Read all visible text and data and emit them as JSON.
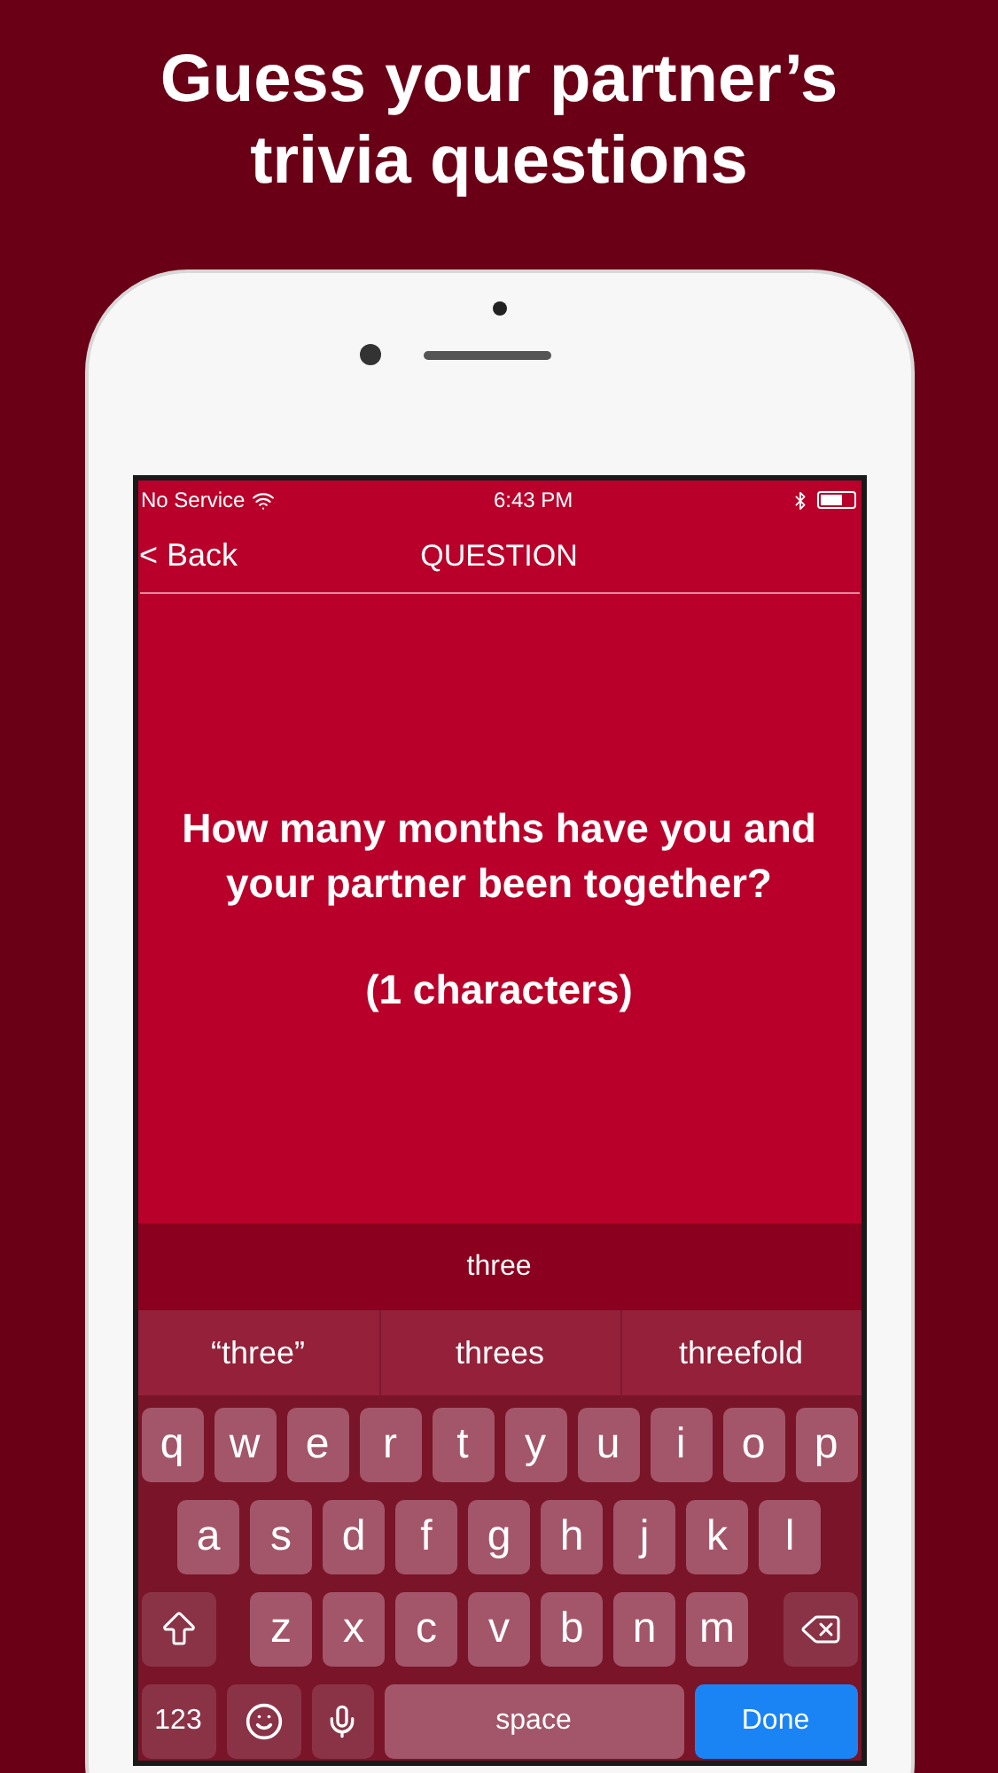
{
  "headline": "Guess your partner’s trivia questions",
  "status_bar": {
    "carrier": "No Service",
    "time": "6:43 PM"
  },
  "nav": {
    "back": "< Back",
    "title": "QUESTION"
  },
  "question": "How many months have you and your partner been together?",
  "hint": "(1 characters)",
  "input": {
    "value": "three"
  },
  "suggestions": [
    "“three”",
    "threes",
    "threefold"
  ],
  "keyboard": {
    "row_1": [
      {
        "kind": "letter",
        "label": "q"
      },
      {
        "kind": "letter",
        "label": "w"
      },
      {
        "kind": "letter",
        "label": "e"
      },
      {
        "kind": "letter",
        "label": "r"
      },
      {
        "kind": "letter",
        "label": "t"
      },
      {
        "kind": "letter",
        "label": "y"
      },
      {
        "kind": "letter",
        "label": "u"
      },
      {
        "kind": "letter",
        "label": "i"
      },
      {
        "kind": "letter",
        "label": "o"
      },
      {
        "kind": "letter",
        "label": "p"
      }
    ],
    "row_2": [
      {
        "kind": "letter",
        "label": "a"
      },
      {
        "kind": "letter",
        "label": "s"
      },
      {
        "kind": "letter",
        "label": "d"
      },
      {
        "kind": "letter",
        "label": "f"
      },
      {
        "kind": "letter",
        "label": "g"
      },
      {
        "kind": "letter",
        "label": "h"
      },
      {
        "kind": "letter",
        "label": "j"
      },
      {
        "kind": "letter",
        "label": "k"
      },
      {
        "kind": "letter",
        "label": "l"
      }
    ],
    "row_3": [
      {
        "kind": "shift"
      },
      {
        "kind": "letter",
        "label": "z"
      },
      {
        "kind": "letter",
        "label": "x"
      },
      {
        "kind": "letter",
        "label": "c"
      },
      {
        "kind": "letter",
        "label": "v"
      },
      {
        "kind": "letter",
        "label": "b"
      },
      {
        "kind": "letter",
        "label": "n"
      },
      {
        "kind": "letter",
        "label": "m"
      },
      {
        "kind": "delete"
      }
    ],
    "bottom_row": [
      {
        "kind": "numbers",
        "label": "123"
      },
      {
        "kind": "emoji"
      },
      {
        "kind": "mic"
      },
      {
        "kind": "space",
        "label": "space"
      },
      {
        "kind": "done",
        "label": "Done"
      }
    ]
  }
}
